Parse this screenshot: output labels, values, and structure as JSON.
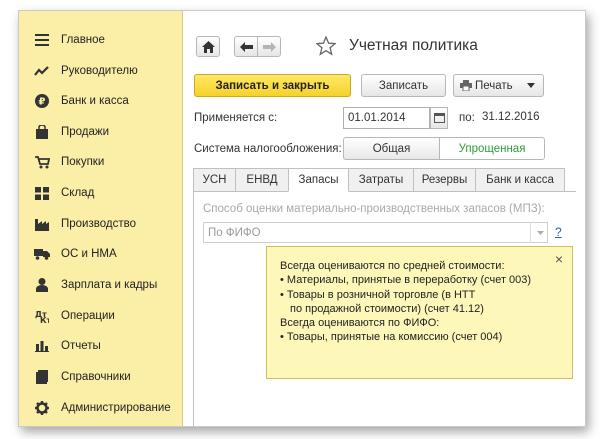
{
  "sidebar": {
    "items": [
      {
        "icon": "menu-icon",
        "label": "Главное"
      },
      {
        "icon": "chart-line-icon",
        "label": "Руководителю"
      },
      {
        "icon": "ruble-coin-icon",
        "label": "Банк и касса"
      },
      {
        "icon": "shopping-bag-icon",
        "label": "Продажи"
      },
      {
        "icon": "cart-icon",
        "label": "Покупки"
      },
      {
        "icon": "warehouse-icon",
        "label": "Склад"
      },
      {
        "icon": "factory-icon",
        "label": "Производство"
      },
      {
        "icon": "truck-icon",
        "label": "ОС и НМА"
      },
      {
        "icon": "person-icon",
        "label": "Зарплата и кадры"
      },
      {
        "icon": "operations-icon",
        "label": "Операции"
      },
      {
        "icon": "bar-chart-icon",
        "label": "Отчеты"
      },
      {
        "icon": "book-icon",
        "label": "Справочники"
      },
      {
        "icon": "gear-icon",
        "label": "Администрирование"
      }
    ]
  },
  "header": {
    "title": "Учетная политика"
  },
  "toolbar": {
    "save_close_label": "Записать и закрыть",
    "save_label": "Записать",
    "print_label": "Печать"
  },
  "form": {
    "applies_from_label": "Применяется с:",
    "applies_from_value": "01.01.2014",
    "to_label": "по:",
    "to_value": "31.12.2016",
    "tax_system_label": "Система налогообложения:",
    "tax_options": [
      "Общая",
      "Упрощенная"
    ],
    "tax_selected": "Упрощенная"
  },
  "tabs": [
    "УСН",
    "ЕНВД",
    "Запасы",
    "Затраты",
    "Резервы",
    "Банк и касса"
  ],
  "active_tab": "Запасы",
  "inventory": {
    "method_label": "Способ оценки материально-производственных запасов (МПЗ):",
    "method_value": "По ФИФО",
    "help_label": "?"
  },
  "tooltip": {
    "lines": [
      "Всегда оцениваются по средней стоимости:",
      "• Материалы, принятые в переработку (счет 003)",
      "• Товары в розничной торговле (в НТТ",
      "   по продажной стоимости) (счет 41.12)",
      "Всегда оцениваются по ФИФО:",
      "• Товары, принятые на комиссию (счет 004)"
    ],
    "close": "×"
  },
  "colors": {
    "sidebar_bg": "#fbeea6",
    "accent_button": "#f5d22a",
    "tooltip_bg": "#fdf7b9",
    "selected_green": "#2e9b3a"
  }
}
